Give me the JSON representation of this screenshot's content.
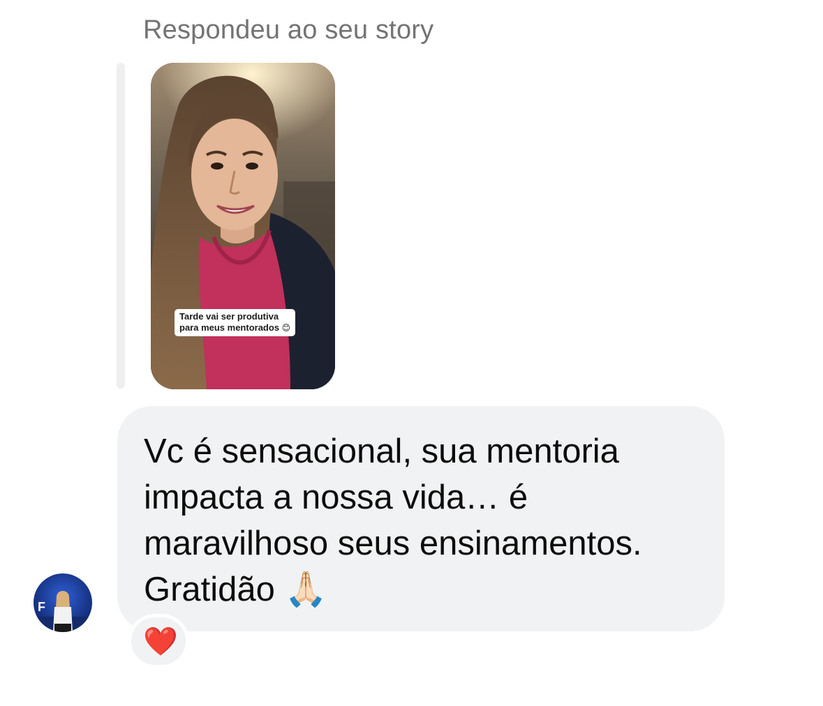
{
  "reply": {
    "header_text": "Respondeu ao seu story"
  },
  "story": {
    "caption_line1": "Tarde vai ser produtiva",
    "caption_line2": "para meus mentorados",
    "caption_emoji": "😊"
  },
  "message": {
    "text": "Vc é sensacional, sua mentoria\nimpacta a nossa vida… é\nmaravilhoso seus ensinamentos.\nGratidão 🙏🏻"
  },
  "reaction": {
    "emoji": "❤️"
  },
  "colors": {
    "bubble_background": "#f1f2f4",
    "header_text": "#737373",
    "reply_bar": "#efefef"
  }
}
